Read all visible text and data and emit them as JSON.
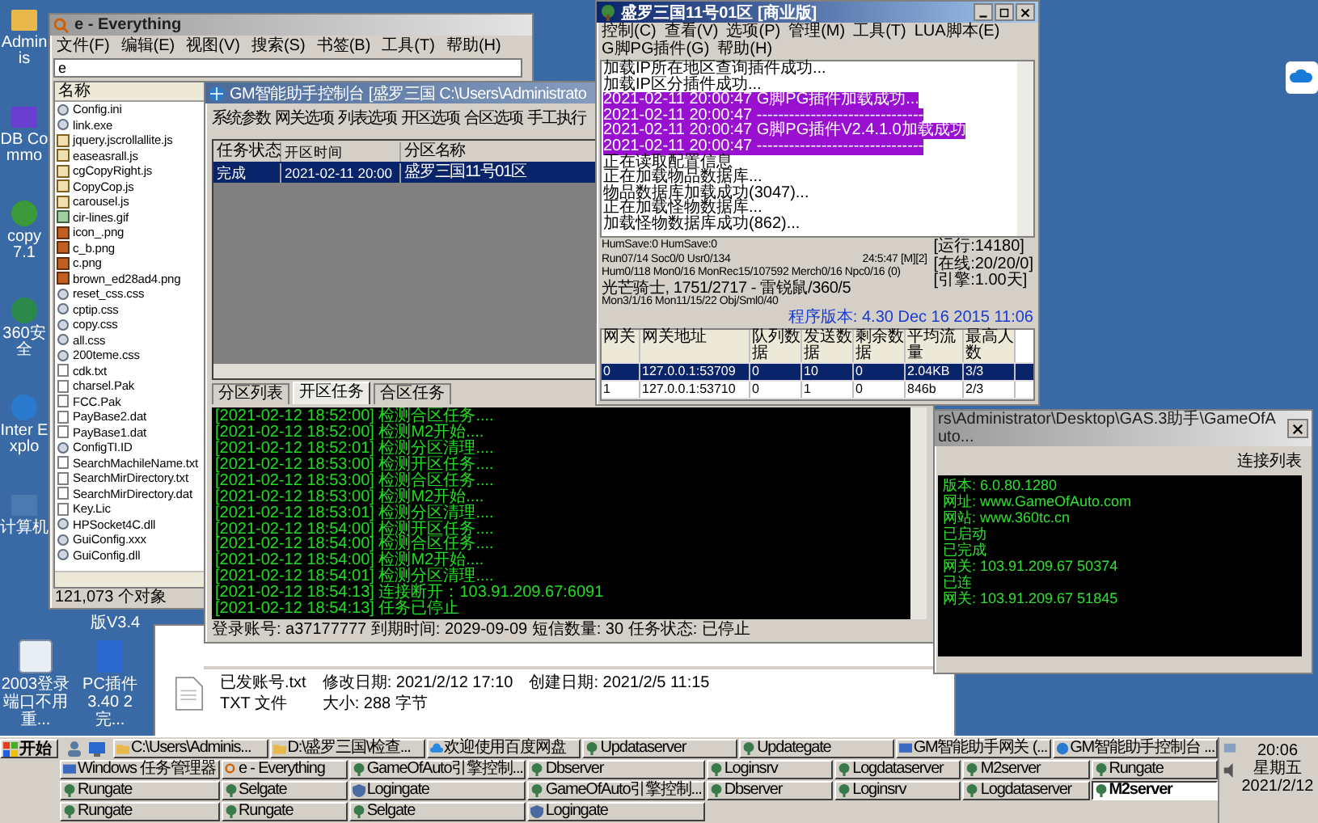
{
  "desktop_icons": [
    {
      "label": "Adminis",
      "kind": "folder"
    },
    {
      "label": "DB Commo",
      "kind": "db"
    },
    {
      "label": "copy 7.1",
      "kind": "frog"
    },
    {
      "label": "360安全",
      "kind": "shield"
    },
    {
      "label": "Inter Explo",
      "kind": "globe"
    },
    {
      "label": "计算机",
      "kind": "computer"
    }
  ],
  "desktop_icons_bottom": [
    {
      "label": "2003登录端口不用重...",
      "kind": "gear"
    },
    {
      "label": "PC插件 3.40 2完...",
      "kind": "archive"
    }
  ],
  "hidden_icon_label": "版V3.4",
  "everything": {
    "title": "e - Everything",
    "menu": [
      "文件(F)",
      "编辑(E)",
      "视图(V)",
      "搜索(S)",
      "书签(B)",
      "工具(T)",
      "帮助(H)"
    ],
    "search": {
      "value": "e"
    },
    "column": "名称",
    "files": [
      {
        "name": "Config.ini",
        "kind": "gear"
      },
      {
        "name": "link.exe",
        "kind": "gear"
      },
      {
        "name": "jquery.jscrollallite.js",
        "kind": "script"
      },
      {
        "name": "easeasrall.js",
        "kind": "script"
      },
      {
        "name": "cgCopyRight.js",
        "kind": "script"
      },
      {
        "name": "CopyCop.js",
        "kind": "script"
      },
      {
        "name": "carousel.js",
        "kind": "script"
      },
      {
        "name": "cir-lines.gif",
        "kind": "image"
      },
      {
        "name": "icon_.png",
        "kind": "photo"
      },
      {
        "name": "c_b.png",
        "kind": "photo"
      },
      {
        "name": "c.png",
        "kind": "photo"
      },
      {
        "name": "brown_ed28ad4.png",
        "kind": "photo"
      },
      {
        "name": "reset_css.css",
        "kind": "gear"
      },
      {
        "name": "cptip.css",
        "kind": "gear"
      },
      {
        "name": "copy.css",
        "kind": "gear"
      },
      {
        "name": "all.css",
        "kind": "gear"
      },
      {
        "name": "200teme.css",
        "kind": "gear"
      },
      {
        "name": "cdk.txt",
        "kind": "doc"
      },
      {
        "name": "charsel.Pak",
        "kind": "doc"
      },
      {
        "name": "FCC.Pak",
        "kind": "doc"
      },
      {
        "name": "PayBase2.dat",
        "kind": "doc"
      },
      {
        "name": "PayBase1.dat",
        "kind": "doc"
      },
      {
        "name": "ConfigTI.ID",
        "kind": "gear"
      },
      {
        "name": "SearchMachileName.txt",
        "kind": "doc"
      },
      {
        "name": "SearchMirDirectory.txt",
        "kind": "doc"
      },
      {
        "name": "SearchMirDirectory.dat",
        "kind": "doc"
      },
      {
        "name": "Key.Lic",
        "kind": "doc"
      },
      {
        "name": "HPSocket4C.dll",
        "kind": "gear"
      },
      {
        "name": "GuiConfig.xxx",
        "kind": "gear"
      },
      {
        "name": "GuiConfig.dll",
        "kind": "gear"
      }
    ],
    "status": "121,073 个对象"
  },
  "gm_console": {
    "title": "GM智能助手控制台 [盛罗三国 C:\\Users\\Administrato",
    "toolbar": [
      "系统参数",
      "网关选项",
      "列表选项",
      "开区选项",
      "合区选项",
      "手工执行"
    ],
    "table": {
      "columns": [
        "任务状态",
        "开区时间",
        "分区名称"
      ],
      "rows": [
        {
          "cells": [
            "完成",
            "2021-02-11 20:00",
            "盛罗三国11号01区"
          ],
          "selected": true
        }
      ]
    },
    "tabs": [
      {
        "label": "分区列表",
        "selected": false
      },
      {
        "label": "开区任务",
        "selected": true
      },
      {
        "label": "合区任务",
        "selected": false
      }
    ],
    "log": [
      "[2021-02-12 18:52:00] 检测合区任务....",
      "[2021-02-12 18:52:00] 检测M2开始....",
      "[2021-02-12 18:52:01] 检测分区清理....",
      "[2021-02-12 18:53:00] 检测开区任务....",
      "[2021-02-12 18:53:00] 检测合区任务....",
      "[2021-02-12 18:53:00] 检测M2开始....",
      "[2021-02-12 18:53:01] 检测分区清理....",
      "[2021-02-12 18:54:00] 检测开区任务....",
      "[2021-02-12 18:54:00] 检测合区任务....",
      "[2021-02-12 18:54:00] 检测M2开始....",
      "[2021-02-12 18:54:01] 检测分区清理....",
      "[2021-02-12 18:54:13] 连接断开：103.91.209.67:6091",
      "[2021-02-12 18:54:13] 任务已停止"
    ],
    "status": "登录账号: a37177777 到期时间: 2029-09-09 短信数量: 30 任务状态: 已停止"
  },
  "m2server": {
    "title": "盛罗三国11号01区 [商业版]",
    "menu": [
      "控制(C)",
      "查看(V)",
      "选项(P)",
      "管理(M)",
      "工具(T)",
      "LUA脚本(E)",
      "G脚PG插件(G)",
      "帮助(H)"
    ],
    "log": [
      {
        "text": "加载IP所在地区查询插件成功...",
        "highlight": false
      },
      {
        "text": "加载IP区分插件成功...",
        "highlight": false
      },
      {
        "text": "2021-02-11 20:00:47 G脚PG插件加载成功...",
        "highlight": true
      },
      {
        "text": "2021-02-11 20:00:47 -------------------------------",
        "highlight": true
      },
      {
        "text": "2021-02-11 20:00:47 G脚PG插件V2.4.1.0加载成功",
        "highlight": true
      },
      {
        "text": "2021-02-11 20:00:47 -------------------------------",
        "highlight": true
      },
      {
        "text": "正在读取配置信息",
        "highlight": false
      },
      {
        "text": "正在加载物品数据库...",
        "highlight": false
      },
      {
        "text": "物品数据库加载成功(3047)...",
        "highlight": false
      },
      {
        "text": "正在加载怪物数据库...",
        "highlight": false
      },
      {
        "text": "加载怪物数据库成功(862)...",
        "highlight": false
      }
    ],
    "stats": [
      {
        "text": "HumSave:0 HumSave:0"
      },
      {
        "text": "Run07/14 Soc0/0 Usr0/134",
        "clock": "24:5:47 [M][2]"
      },
      {
        "text": "Hum0/118 Mon0/16 MonRec15/107592 Merch0/16 Npc0/16 (0)"
      },
      {
        "text": "光芒骑士, 1751/2717 - 雷锐鼠/360/5"
      },
      {
        "text": "Mon3/1/16 Mon11/15/22 Obj/Sml0/40"
      }
    ],
    "stats_right": [
      "[运行:14180]",
      "[在线:20/20/0]",
      "[引擎:1.00天]"
    ],
    "version": "程序版本: 4.30 Dec 16 2015 11:06",
    "table": {
      "columns": [
        "网关",
        "网关地址",
        "队列数据",
        "发送数据",
        "剩余数据",
        "平均流量",
        "最高人数"
      ],
      "rows": [
        {
          "cells": [
            "0",
            "127.0.0.1:53709",
            "0",
            "10",
            "0",
            "2.04KB",
            "3/3"
          ],
          "selected": true
        },
        {
          "cells": [
            "1",
            "127.0.0.1:53710",
            "0",
            "1",
            "0",
            "846b",
            "2/3"
          ],
          "selected": false
        }
      ]
    }
  },
  "file_details": {
    "name": "已发账号.txt",
    "type": "TXT 文件",
    "modified": "修改日期: 2021/2/12 17:10",
    "size": "大小: 288 字节",
    "created": "创建日期: 2021/2/5 11:15"
  },
  "gateway_console": {
    "title": "rs\\Administrator\\Desktop\\GAS.3助手\\GameOfAuto...",
    "list_label": "连接列表",
    "lines": [
      "版本: 6.0.80.1280",
      "网址: www.GameOfAuto.com",
      "网站: www.360tc.cn",
      "已启动",
      "已完成",
      "网关: 103.91.209.67 50374",
      "已连",
      "网关: 103.91.209.67 51845"
    ]
  },
  "taskbar": {
    "start": "开始",
    "top_row": [
      {
        "label": "C:\\Users\\Adminis...",
        "kind": "folder",
        "selected": false
      },
      {
        "label": "D:\\盛罗三国\\检查...",
        "kind": "folder",
        "selected": false
      },
      {
        "label": "欢迎使用百度网盘",
        "kind": "cloud",
        "selected": false
      },
      {
        "label": "Updataserver",
        "kind": "app",
        "selected": false
      },
      {
        "label": "Updategate",
        "kind": "app",
        "selected": false
      },
      {
        "label": "GM智能助手网关 (...",
        "kind": "monitor",
        "selected": false
      },
      {
        "label": "GM智能助手控制台 ...",
        "kind": "globe",
        "selected": false
      }
    ],
    "buttons": [
      {
        "label": "Windows 任务管理器",
        "kind": "monitor",
        "selected": false
      },
      {
        "label": "e - Everything",
        "kind": "search",
        "selected": false
      },
      {
        "label": "GameOfAuto引擎控制...",
        "kind": "app",
        "selected": false
      },
      {
        "label": "Dbserver",
        "kind": "app",
        "selected": false
      },
      {
        "label": "Loginsrv",
        "kind": "app",
        "selected": false
      },
      {
        "label": "Logdataserver",
        "kind": "app",
        "selected": false
      },
      {
        "label": "M2server",
        "kind": "app",
        "selected": false
      },
      {
        "label": "Rungate",
        "kind": "app",
        "selected": false
      },
      {
        "label": "Rungate",
        "kind": "app",
        "selected": false
      },
      {
        "label": "Selgate",
        "kind": "app",
        "selected": false
      },
      {
        "label": "Logingate",
        "kind": "shield",
        "selected": false
      },
      {
        "label": "GameOfAuto引擎控制...",
        "kind": "app",
        "selected": false
      },
      {
        "label": "Dbserver",
        "kind": "app",
        "selected": false
      },
      {
        "label": "Loginsrv",
        "kind": "app",
        "selected": false
      },
      {
        "label": "Logdataserver",
        "kind": "app",
        "selected": false
      },
      {
        "label": "M2server",
        "kind": "app",
        "selected": true
      },
      {
        "label": "Rungate",
        "kind": "app",
        "selected": false
      },
      {
        "label": "Rungate",
        "kind": "app",
        "selected": false
      },
      {
        "label": "Selgate",
        "kind": "app",
        "selected": false
      },
      {
        "label": "Logingate",
        "kind": "shield",
        "selected": false
      }
    ],
    "clock": {
      "time": "20:06",
      "weekday": "星期五",
      "date": "2021/2/12"
    }
  }
}
